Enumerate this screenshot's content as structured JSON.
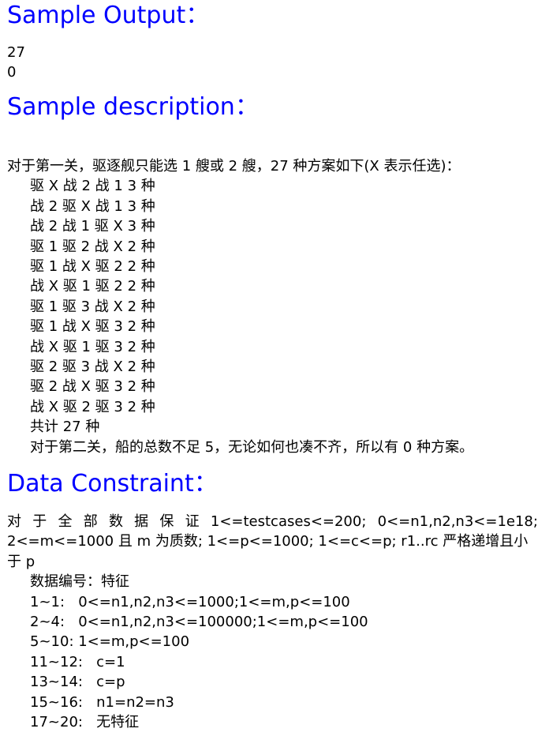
{
  "heading_color": "#0000ff",
  "sample_output": {
    "title": "Sample Output：",
    "lines": [
      "27",
      "0"
    ]
  },
  "sample_description": {
    "title": "Sample description：",
    "intro": "对于第一关，驱逐舰只能选 1 艘或 2 艘，27 种方案如下(X 表示任选)：",
    "cases": [
      "驱 X 战 2 战 1 3 种",
      "战 2 驱 X 战 1 3 种",
      "战 2 战 1 驱 X 3 种",
      "驱 1 驱 2 战 X 2 种",
      "驱 1 战 X 驱 2 2 种",
      "战 X 驱 1 驱 2 2 种",
      "驱 1 驱 3 战 X 2 种",
      "驱 1 战 X 驱 3 2 种",
      "战 X 驱 1 驱 3 2 种",
      "驱 2 驱 3 战 X 2 种",
      "驱 2 战 X 驱 3 2 种",
      "战 X 驱 2 驱 3 2 种"
    ],
    "total": "共计 27 种",
    "second": "对于第二关，船的总数不足 5，无论如何也凑不齐，所以有 0 种方案。"
  },
  "data_constraint": {
    "title": "Data Constraint：",
    "para_line1_words": [
      "对",
      "于",
      "全",
      "部",
      "数",
      "据",
      "保",
      "证",
      "1<=testcases<=200;",
      "0<=n1,n2,n3<=1e18;"
    ],
    "para_line2": "2<=m<=1000 且 m 为质数; 1<=p<=1000; 1<=c<=p; r1..rc 严格递增且小",
    "para_line3": "于 p",
    "table_header": "数据编号：特征",
    "rows": [
      "1~1:   0<=n1,n2,n3<=1000;1<=m,p<=100",
      "2~4:   0<=n1,n2,n3<=100000;1<=m,p<=100",
      "5~10: 1<=m,p<=100",
      "11~12:   c=1",
      "13~14:   c=p",
      "15~16:   n1=n2=n3",
      "17~20:   无特征"
    ]
  }
}
